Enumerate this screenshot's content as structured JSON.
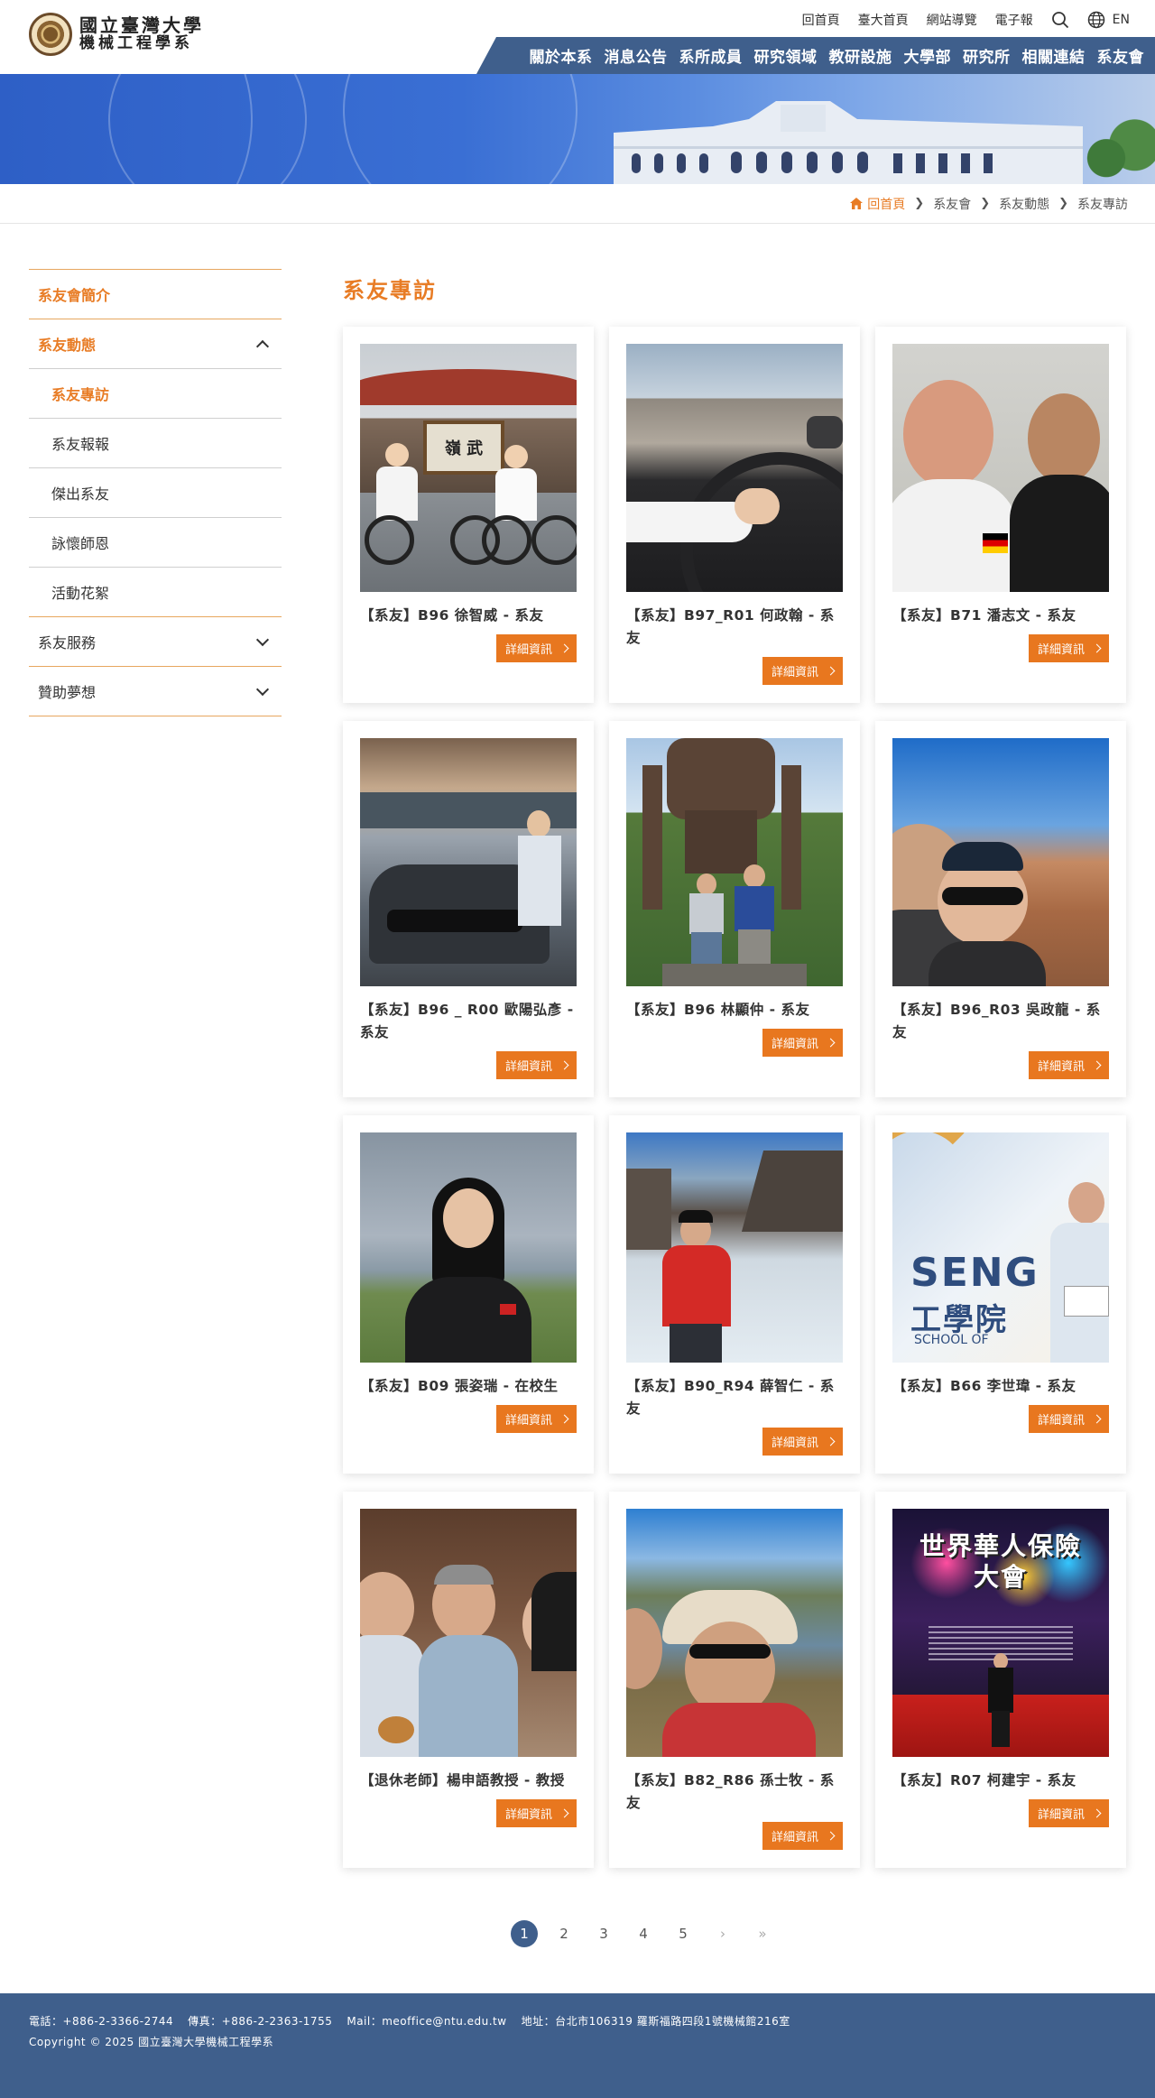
{
  "header": {
    "logo_line1": "國立臺灣大學",
    "logo_line2": "機械工程學系",
    "utility_links": [
      "回首頁",
      "臺大首頁",
      "網站導覽",
      "電子報"
    ],
    "lang_label": "EN",
    "nav": [
      "關於本系",
      "消息公告",
      "系所成員",
      "研究領域",
      "教研設施",
      "大學部",
      "研究所",
      "相關連結",
      "系友會"
    ]
  },
  "breadcrumb": [
    "回首頁",
    "系友會",
    "系友動態",
    "系友專訪"
  ],
  "sidebar": {
    "items": [
      {
        "label": "系友會簡介",
        "state": "active",
        "chevron": "none"
      },
      {
        "label": "系友動態",
        "state": "active",
        "chevron": "up"
      },
      {
        "label": "系友服務",
        "state": "normal",
        "chevron": "down"
      },
      {
        "label": "贊助夢想",
        "state": "normal",
        "chevron": "down"
      }
    ],
    "subitems": [
      "系友專訪",
      "系友報報",
      "傑出系友",
      "詠懷師恩",
      "活動花絮"
    ]
  },
  "page_title": "系友專訪",
  "more_label": "詳細資訊",
  "cards": [
    {
      "title": "【系友】B96 徐智威 - 系友"
    },
    {
      "title": "【系友】B97_R01 何政翰 - 系友"
    },
    {
      "title": "【系友】B71 潘志文 - 系友"
    },
    {
      "title": "【系友】B96 _ R00 歐陽弘彥 - 系友"
    },
    {
      "title": "【系友】B96 林顯仲 - 系友"
    },
    {
      "title": "【系友】B96_R03 吳政龍 - 系友"
    },
    {
      "title": "【系友】B09 張姿瑞 - 在校生"
    },
    {
      "title": "【系友】B90_R94 薛智仁 - 系友"
    },
    {
      "title": "【系友】B66 李世瑋 - 系友"
    },
    {
      "title": "【退休老師】楊申語教授 - 教授"
    },
    {
      "title": "【系友】B82_R86 孫士牧 - 系友"
    },
    {
      "title": "【系友】R07 柯建宇 - 系友"
    }
  ],
  "photo_text": {
    "sign": "嶺 武",
    "seng": "SENG",
    "college": "工學院",
    "school": "SCHOOL OF",
    "event": "世界華人保險大會"
  },
  "pagination": {
    "pages": [
      "1",
      "2",
      "3",
      "4",
      "5"
    ],
    "current": "1",
    "next": "›",
    "last": "»"
  },
  "footer": {
    "phone": "電話：+886-2-3366-2744",
    "fax": "傳真：+886-2-2363-1755",
    "mail": "Mail：meoffice@ntu.edu.tw",
    "address": "地址：台北市106319 羅斯福路四段1號機械館216室",
    "copyright": "Copyright © 2025 國立臺灣大學機械工程學系"
  }
}
